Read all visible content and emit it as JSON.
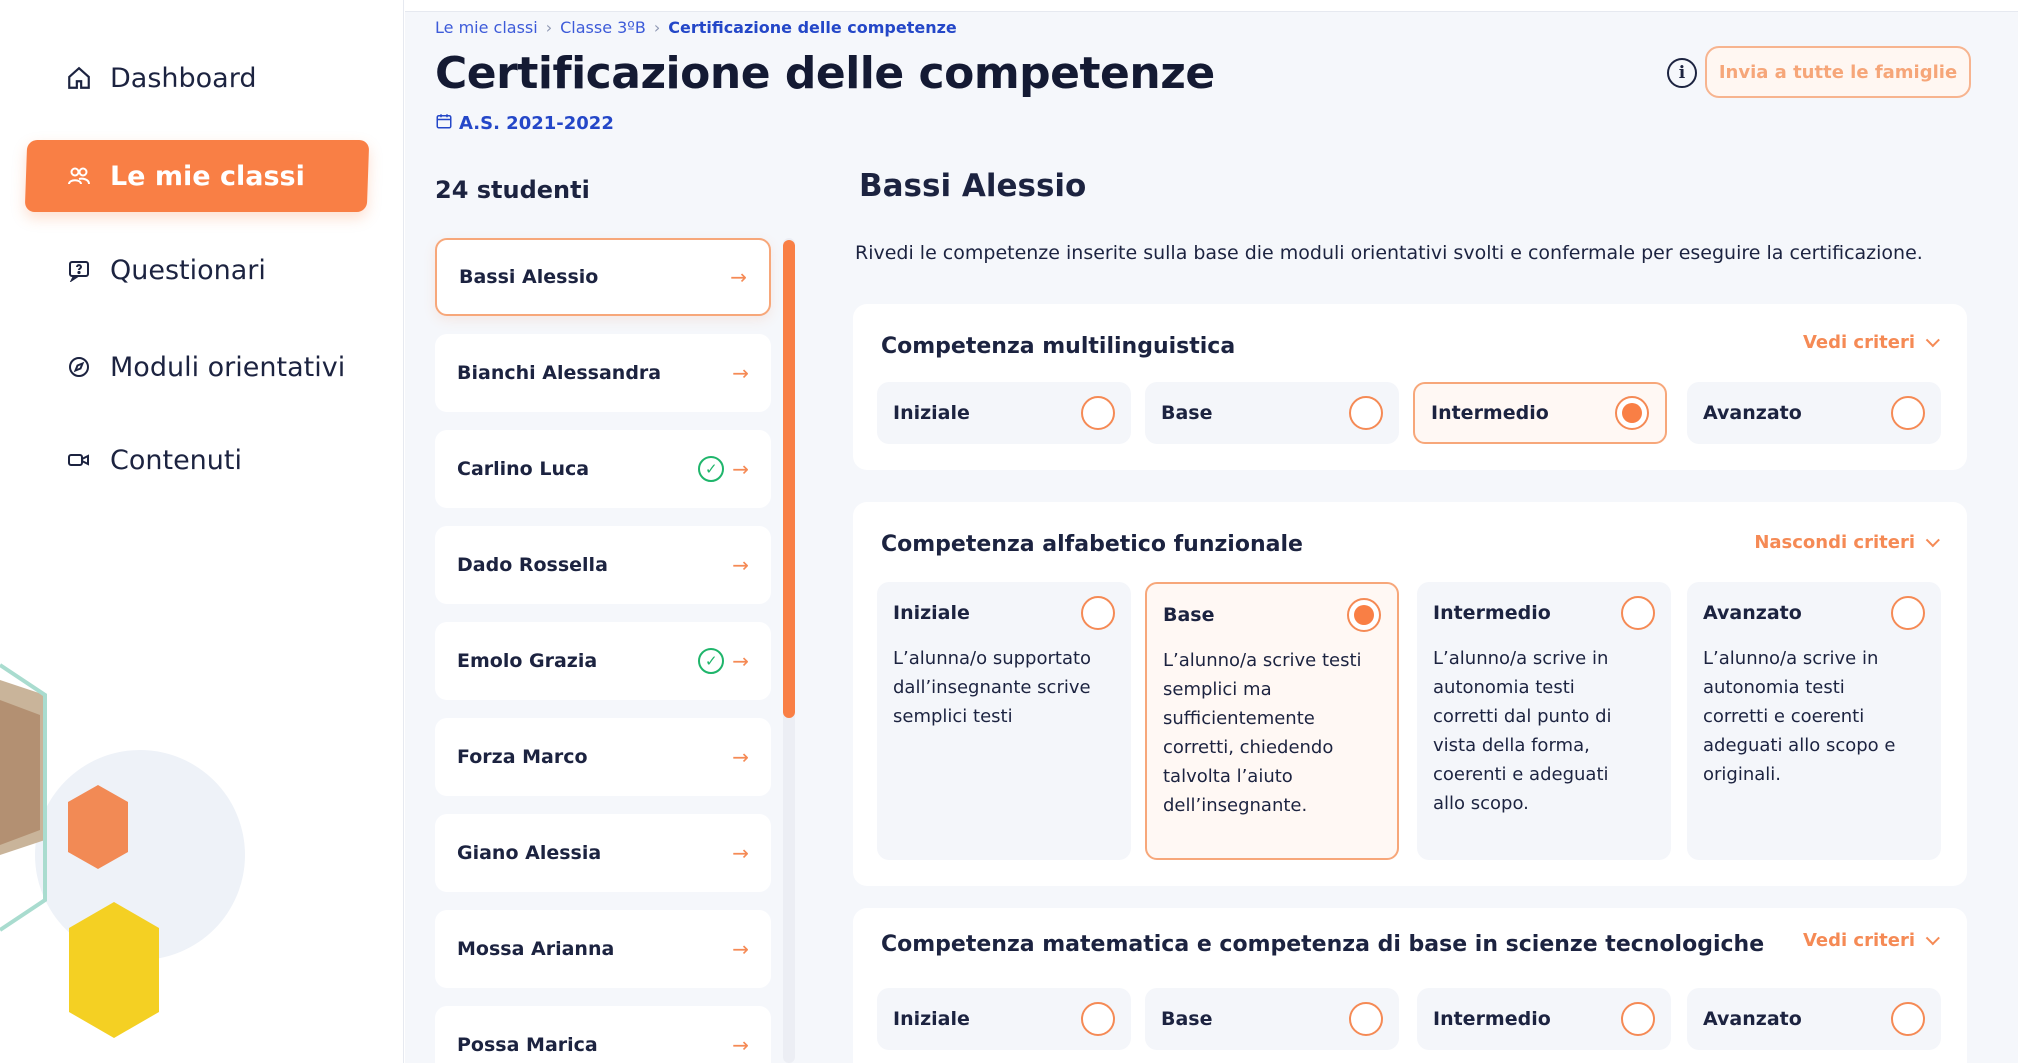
{
  "sidebar": {
    "items": [
      {
        "label": "Dashboard",
        "icon": "home-icon"
      },
      {
        "label": "Le mie classi",
        "icon": "users-icon",
        "active": true
      },
      {
        "label": "Questionari",
        "icon": "questionnaire-icon"
      },
      {
        "label": "Moduli orientativi",
        "icon": "compass-icon"
      },
      {
        "label": "Contenuti",
        "icon": "video-icon"
      }
    ]
  },
  "breadcrumb": {
    "items": [
      "Le mie classi",
      "Classe 3ºB"
    ],
    "current": "Certificazione delle competenze"
  },
  "header": {
    "title": "Certificazione delle competenze",
    "year": "A.S. 2021-2022",
    "send_button": "Invia a tutte le famiglie"
  },
  "students": {
    "count_label": "24 studenti",
    "list": [
      {
        "name": "Bassi Alessio",
        "active": true,
        "done": false
      },
      {
        "name": "Bianchi Alessandra",
        "done": false
      },
      {
        "name": "Carlino Luca",
        "done": true
      },
      {
        "name": "Dado Rossella",
        "done": false
      },
      {
        "name": "Emolo Grazia",
        "done": true
      },
      {
        "name": "Forza Marco",
        "done": false
      },
      {
        "name": "Giano Alessia",
        "done": false
      },
      {
        "name": "Mossa Arianna",
        "done": false
      },
      {
        "name": "Possa Marica",
        "done": false
      }
    ]
  },
  "detail": {
    "student_name": "Bassi Alessio",
    "description": "Rivedi le competenze inserite sulla base die moduli orientativi svolti e confermale per eseguire la certificazione.",
    "competences": [
      {
        "title": "Competenza multilinguistica",
        "toggle_label": "Vedi criteri",
        "levels": [
          {
            "label": "Iniziale",
            "selected": false
          },
          {
            "label": "Base",
            "selected": false
          },
          {
            "label": "Intermedio",
            "selected": true
          },
          {
            "label": "Avanzato",
            "selected": false
          }
        ]
      },
      {
        "title": "Competenza alfabetico funzionale",
        "toggle_label": "Nascondi criteri",
        "levels": [
          {
            "label": "Iniziale",
            "selected": false,
            "description": "L’alunna/o supportato dall’insegnante scrive semplici testi"
          },
          {
            "label": "Base",
            "selected": true,
            "description": "L’alunno/a scrive testi semplici ma sufficientemente corretti, chiedendo talvolta l’aiuto dell’insegnante."
          },
          {
            "label": "Intermedio",
            "selected": false,
            "description": "L’alunno/a scrive in autonomia testi corretti dal punto di vista della forma, coerenti e adeguati allo scopo."
          },
          {
            "label": "Avanzato",
            "selected": false,
            "description": "L’alunno/a scrive in autonomia testi corretti e coerenti adeguati allo scopo e originali."
          }
        ]
      },
      {
        "title": "Competenza matematica e competenza di base in scienze tecnologiche",
        "toggle_label": "Vedi criteri",
        "levels": [
          {
            "label": "Iniziale",
            "selected": false
          },
          {
            "label": "Base",
            "selected": false
          },
          {
            "label": "Intermedio",
            "selected": false
          },
          {
            "label": "Avanzato",
            "selected": false
          }
        ]
      }
    ]
  },
  "colors": {
    "accent": "#f97f45",
    "link": "#2447c8",
    "success": "#1fb56b",
    "background": "#f5f7fb"
  }
}
